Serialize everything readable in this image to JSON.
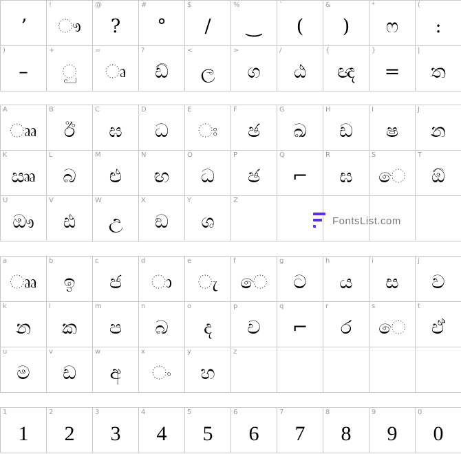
{
  "sections": [
    {
      "id": "punctuation",
      "cells": [
        {
          "key": "",
          "glyph": "ʼ"
        },
        {
          "key": "!",
          "glyph": "ෟ"
        },
        {
          "key": "@",
          "glyph": "?"
        },
        {
          "key": "#",
          "glyph": "°"
        },
        {
          "key": "$",
          "glyph": "/"
        },
        {
          "key": "%",
          "glyph": "‿"
        },
        {
          "key": "`",
          "glyph": "("
        },
        {
          "key": "&",
          "glyph": ")"
        },
        {
          "key": "*",
          "glyph": "ෆ"
        },
        {
          "key": "(",
          "glyph": ":"
        },
        {
          "key": ")",
          "glyph": "–"
        },
        {
          "key": "+",
          "glyph": "ු"
        },
        {
          "key": "=",
          "glyph": "ෘ"
        },
        {
          "key": "?",
          "glyph": "ඩ්"
        },
        {
          "key": "<",
          "glyph": "ල"
        },
        {
          "key": ">",
          "glyph": "ග"
        },
        {
          "key": "/",
          "glyph": "ඨ"
        },
        {
          "key": "{",
          "glyph": "ඥ"
        },
        {
          "key": "}",
          "glyph": "="
        },
        {
          "key": "|",
          "glyph": "ත"
        }
      ]
    },
    {
      "id": "uppercase",
      "cells": [
        {
          "key": "A",
          "glyph": "ෲ"
        },
        {
          "key": "B",
          "glyph": "ඊ"
        },
        {
          "key": "C",
          "glyph": "ඝ"
        },
        {
          "key": "D",
          "glyph": "ධ"
        },
        {
          "key": "E",
          "glyph": "ඃ"
        },
        {
          "key": "F",
          "glyph": "ඡ"
        },
        {
          "key": "G",
          "glyph": "ඛ"
        },
        {
          "key": "H",
          "glyph": "ඩ"
        },
        {
          "key": "I",
          "glyph": "ෂ"
        },
        {
          "key": "J",
          "glyph": "න"
        },
        {
          "key": "K",
          "glyph": "ඎ"
        },
        {
          "key": "L",
          "glyph": "බ"
        },
        {
          "key": "M",
          "glyph": "ළු"
        },
        {
          "key": "N",
          "glyph": "ඟ"
        },
        {
          "key": "O",
          "glyph": "ධ"
        },
        {
          "key": "P",
          "glyph": "ඡ"
        },
        {
          "key": "Q",
          "glyph": "⌐"
        },
        {
          "key": "R",
          "glyph": "ඝ"
        },
        {
          "key": "S",
          "glyph": "ෙ"
        },
        {
          "key": "T",
          "glyph": "ඕ"
        },
        {
          "key": "U",
          "glyph": "ඖ"
        },
        {
          "key": "V",
          "glyph": "ඪ"
        },
        {
          "key": "W",
          "glyph": "උ"
        },
        {
          "key": "X",
          "glyph": "ඞ"
        },
        {
          "key": "Y",
          "glyph": "ශ"
        },
        {
          "key": "Z",
          "glyph": ""
        },
        {
          "key": "",
          "glyph": ""
        },
        {
          "key": "",
          "glyph": ""
        },
        {
          "key": "",
          "glyph": ""
        },
        {
          "key": "",
          "glyph": ""
        }
      ]
    },
    {
      "id": "lowercase",
      "cells": [
        {
          "key": "a",
          "glyph": "ෲ"
        },
        {
          "key": "b",
          "glyph": "ඉ"
        },
        {
          "key": "c",
          "glyph": "ජ"
        },
        {
          "key": "d",
          "glyph": "ා"
        },
        {
          "key": "e",
          "glyph": "ැ"
        },
        {
          "key": "f",
          "glyph": "ෙ"
        },
        {
          "key": "g",
          "glyph": "ට"
        },
        {
          "key": "h",
          "glyph": "ය"
        },
        {
          "key": "i",
          "glyph": "ස"
        },
        {
          "key": "j",
          "glyph": "ව"
        },
        {
          "key": "k",
          "glyph": "න"
        },
        {
          "key": "l",
          "glyph": "ක"
        },
        {
          "key": "m",
          "glyph": "ප"
        },
        {
          "key": "n",
          "glyph": "බ"
        },
        {
          "key": "o",
          "glyph": "ද"
        },
        {
          "key": "p",
          "glyph": "ච"
        },
        {
          "key": "q",
          "glyph": "⌐"
        },
        {
          "key": "r",
          "glyph": "ර"
        },
        {
          "key": "s",
          "glyph": "ෙ"
        },
        {
          "key": "t",
          "glyph": "ඒ"
        },
        {
          "key": "u",
          "glyph": "ම"
        },
        {
          "key": "v",
          "glyph": "ඩ"
        },
        {
          "key": "w",
          "glyph": "අ"
        },
        {
          "key": "x",
          "glyph": "ං"
        },
        {
          "key": "y",
          "glyph": "හ"
        },
        {
          "key": "z",
          "glyph": ""
        },
        {
          "key": "",
          "glyph": ""
        },
        {
          "key": "",
          "glyph": ""
        },
        {
          "key": "",
          "glyph": ""
        },
        {
          "key": "",
          "glyph": ""
        }
      ]
    },
    {
      "id": "digits",
      "cells": [
        {
          "key": "1",
          "glyph": "1"
        },
        {
          "key": "2",
          "glyph": "2"
        },
        {
          "key": "3",
          "glyph": "3"
        },
        {
          "key": "4",
          "glyph": "4"
        },
        {
          "key": "5",
          "glyph": "5"
        },
        {
          "key": "6",
          "glyph": "6"
        },
        {
          "key": "7",
          "glyph": "7"
        },
        {
          "key": "8",
          "glyph": "8"
        },
        {
          "key": "9",
          "glyph": "9"
        },
        {
          "key": "0",
          "glyph": "0"
        }
      ]
    }
  ],
  "watermark": {
    "text": "FontsList.com",
    "color": "#5b2fe0"
  }
}
